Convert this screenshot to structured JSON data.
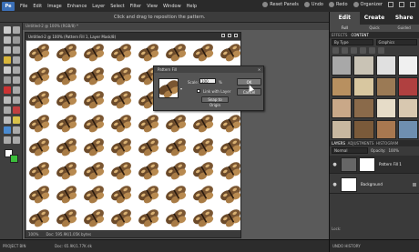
{
  "menu": {
    "items": [
      "File",
      "Edit",
      "Image",
      "Enhance",
      "Layer",
      "Select",
      "Filter",
      "View",
      "Window",
      "Help"
    ],
    "reset_panels": "Reset Panels",
    "undo": "Undo",
    "redo": "Redo",
    "organizer": "Organizer"
  },
  "options": {
    "hint": "Click and drag to reposition the pattern."
  },
  "document": {
    "tab": "Untitled-2 @ 100% (RGB/8) *",
    "title": "Untitled-2 @ 100% (Pattern Fill 1, Layer Mask/8)",
    "zoom": "100%",
    "doc_size": "Doc: 595.9K/1.05K bytes"
  },
  "dialog": {
    "title": "Pattern Fill",
    "scale_label": "Scale:",
    "scale_value": "100",
    "scale_unit": "%",
    "link_label": "Link with Layer",
    "snap_label": "Snap to Origin",
    "ok_label": "OK",
    "cancel_label": "Cancel"
  },
  "bottom": {
    "project_bin": "PROJECT BIN",
    "doc_info": "Doc: 65.9K/1.77K dk"
  },
  "panel": {
    "tab_edit": "Edit",
    "tab_create": "Create",
    "tab_share": "Share",
    "subtab_full": "Full",
    "subtab_quick": "Quick",
    "subtab_guided": "Guided",
    "effects_label": "EFFECTS",
    "content_label": "CONTENT",
    "filter_by": "By Type",
    "filter_kind": "Graphics",
    "layers_label": "LAYERS",
    "adjustments_label": "ADJUSTMENTS",
    "histogram_label": "HISTOGRAM",
    "blend_mode": "Normal",
    "opacity_label": "Opacity:",
    "opacity_value": "100%",
    "lock_label": "Lock:",
    "layer1": "Pattern Fill 1",
    "layer2": "Background",
    "undo_history": "UNDO HISTORY"
  }
}
